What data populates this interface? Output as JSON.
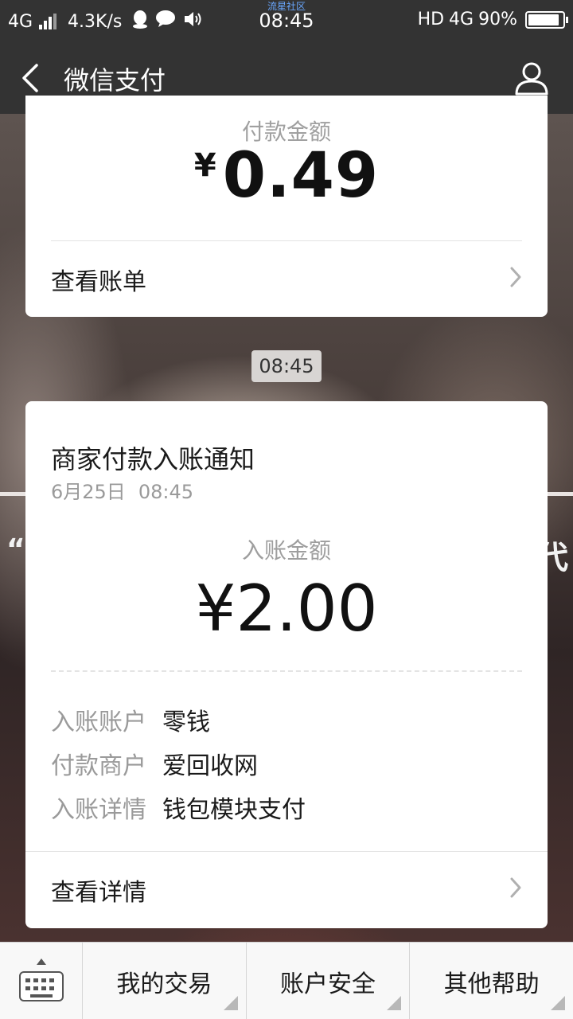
{
  "status_bar": {
    "network_left": "4G",
    "speed": "4.3K/s",
    "community_label": "流星社区",
    "time": "08:45",
    "hd": "HD",
    "network_right": "4G",
    "battery": "90%"
  },
  "nav": {
    "title": "微信支付",
    "back_icon": "chevron-left-icon",
    "user_icon": "user-icon"
  },
  "card1": {
    "label": "付款金额",
    "currency": "¥",
    "amount": "0.49",
    "link_label": "查看账单"
  },
  "time_pill": "08:45",
  "card2": {
    "title": "商家付款入账通知",
    "date": "6月25日",
    "time": "08:45",
    "amount_label": "入账金额",
    "amount": "¥2.00",
    "details": [
      {
        "key": "入账账户",
        "value": "零钱"
      },
      {
        "key": "付款商户",
        "value": "爱回收网"
      },
      {
        "key": "入账详情",
        "value": "钱包模块支付"
      }
    ],
    "link_label": "查看详情"
  },
  "background_text": {
    "left": "“",
    "right": "代"
  },
  "bottom_menu": {
    "keyboard_icon": "keyboard-icon",
    "items": [
      "我的交易",
      "账户安全",
      "其他帮助"
    ]
  },
  "colors": {
    "bar_bg": "#333333",
    "card_bg": "#ffffff",
    "muted_text": "#9a9a9a",
    "community_blue": "#69a7ff"
  }
}
